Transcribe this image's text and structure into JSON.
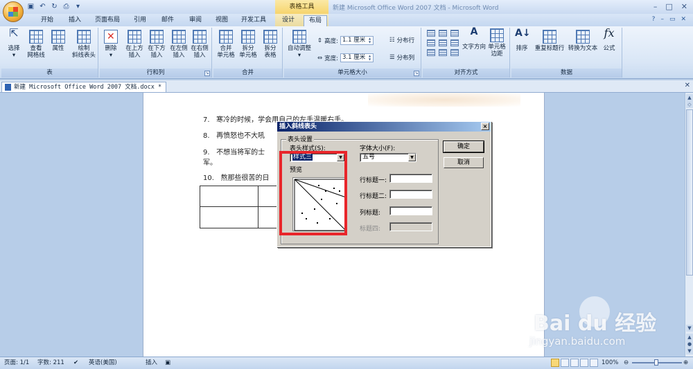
{
  "title_bar": {
    "context_tools": "表格工具",
    "document_title": "新建 Microsoft Office Word 2007 文档 - Microsoft Word"
  },
  "tabs": [
    "开始",
    "插入",
    "页面布局",
    "引用",
    "邮件",
    "审阅",
    "视图",
    "开发工具",
    "设计",
    "布局"
  ],
  "active_tab": "布局",
  "ribbon": {
    "groups": {
      "table": "表",
      "rows_cols": "行和列",
      "merge": "合并",
      "cell_size": "单元格大小",
      "alignment": "对齐方式",
      "data": "数据"
    },
    "buttons": {
      "select": "选择",
      "view_grid_1": "查看",
      "view_grid_2": "网格线",
      "properties": "属性",
      "draw_diag_1": "绘制",
      "draw_diag_2": "斜线表头",
      "delete": "删除",
      "insert_above_1": "在上方",
      "insert_above_2": "插入",
      "insert_below_1": "在下方",
      "insert_below_2": "插入",
      "insert_left_1": "在左侧",
      "insert_left_2": "插入",
      "insert_right_1": "在右侧",
      "insert_right_2": "插入",
      "merge_cells_1": "合并",
      "merge_cells_2": "单元格",
      "split_cells_1": "拆分",
      "split_cells_2": "单元格",
      "split_table_1": "拆分",
      "split_table_2": "表格",
      "autofit": "自动调整",
      "height_label": "高度:",
      "height_value": "1.1 厘米",
      "width_label": "宽度:",
      "width_value": "3.1 厘米",
      "distribute_rows": "分布行",
      "distribute_cols": "分布列",
      "text_direction": "文字方向",
      "cell_margins_1": "单元格",
      "cell_margins_2": "边距",
      "sort": "排序",
      "repeat_header": "重复标题行",
      "convert_text": "转换为文本",
      "formula": "公式"
    }
  },
  "doc_tab": "新建 Microsoft Office Word 2007 文档.docx *",
  "document": {
    "lines": [
      {
        "num": "7.",
        "text": "寒冷的时候，学会用自己的左手温暖右手。"
      },
      {
        "num": "8.",
        "text": "再愤怒也不大吼"
      },
      {
        "num": "9.",
        "text": "不想当将军的士"
      },
      {
        "num": "",
        "text": "军。"
      },
      {
        "num": "10.",
        "text": "熬那些很苦的日"
      }
    ]
  },
  "dialog": {
    "title": "插入斜线表头",
    "close": "×",
    "fieldset": "表头设置",
    "style_label": "表头样式(S):",
    "style_value": "样式三",
    "preview_label": "预览",
    "font_size_label": "字体大小(F):",
    "font_size_value": "五号",
    "row_title_1": "行标题一:",
    "row_title_2": "行标题二:",
    "col_title": "列标题:",
    "title_4": "标题四:",
    "ok": "确定",
    "cancel": "取消"
  },
  "status_bar": {
    "page": "页面: 1/1",
    "words": "字数: 211",
    "language": "英语(美国)",
    "insert": "插入",
    "zoom": "100%"
  },
  "watermark": {
    "brand": "Bai du 经验",
    "url": "jingyan.baidu.com"
  }
}
